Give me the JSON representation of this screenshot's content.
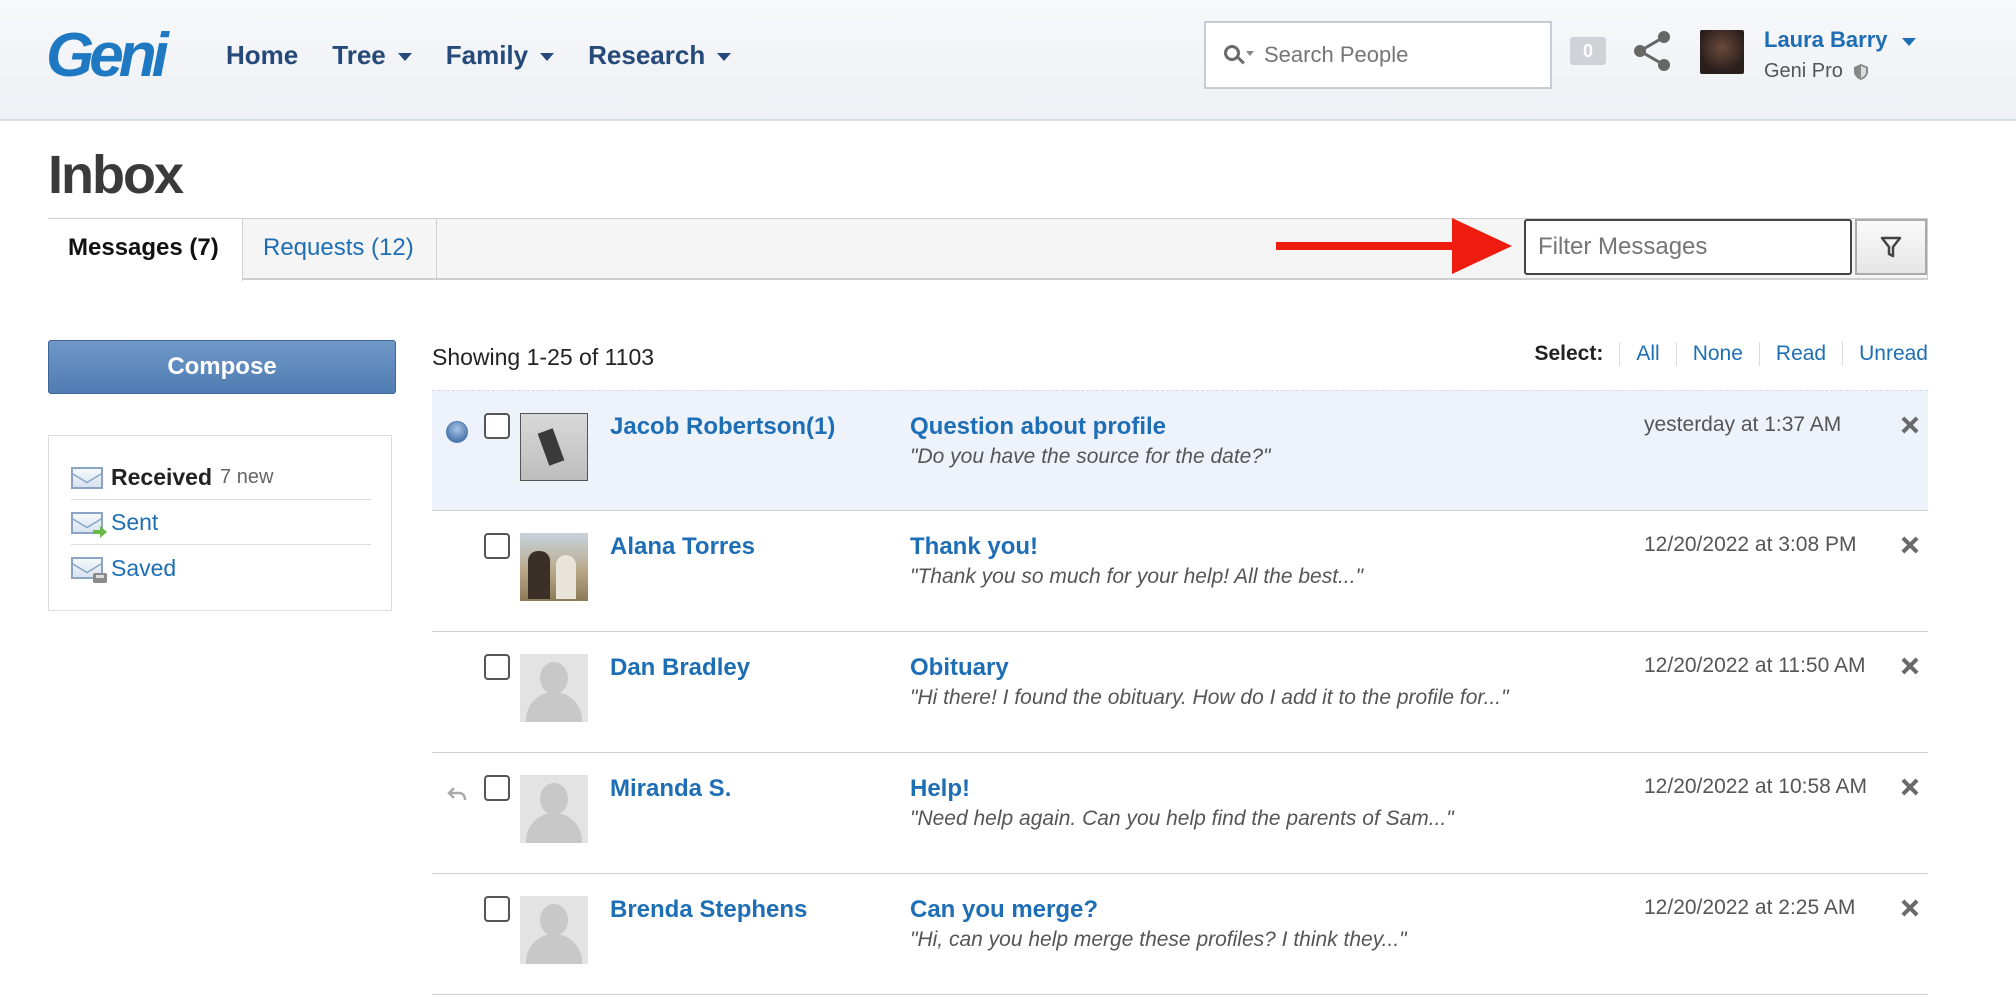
{
  "header": {
    "logo": "Geni",
    "nav": [
      {
        "label": "Home",
        "has_menu": false
      },
      {
        "label": "Tree",
        "has_menu": true
      },
      {
        "label": "Family",
        "has_menu": true
      },
      {
        "label": "Research",
        "has_menu": true
      }
    ],
    "search_placeholder": "Search People",
    "notification_count": "0",
    "user_name": "Laura Barry",
    "user_plan": "Geni Pro"
  },
  "page": {
    "title": "Inbox",
    "tabs": [
      {
        "label": "Messages (7)",
        "active": true
      },
      {
        "label": "Requests (12)",
        "active": false
      }
    ],
    "filter_placeholder": "Filter Messages"
  },
  "sidebar": {
    "compose_label": "Compose",
    "folders": [
      {
        "label": "Received",
        "note": "7 new",
        "icon": "envelope-icon"
      },
      {
        "label": "Sent",
        "note": "",
        "icon": "envelope-send-icon"
      },
      {
        "label": "Saved",
        "note": "",
        "icon": "envelope-save-icon"
      }
    ]
  },
  "list": {
    "showing": "Showing 1-25 of 1103",
    "select_label": "Select:",
    "select_options": [
      "All",
      "None",
      "Read",
      "Unread"
    ],
    "messages": [
      {
        "sender": "Jacob Robertson(1)",
        "subject": "Question about profile",
        "preview": "\"Do you have the source for the date?\"",
        "date": "yesterday at 1:37 AM",
        "status": "unread",
        "thumb": "photo1"
      },
      {
        "sender": "Alana Torres",
        "subject": "Thank you!",
        "preview": "\"Thank you so much for your help! All the best...\"",
        "date": "12/20/2022 at 3:08 PM",
        "status": "",
        "thumb": "photo2"
      },
      {
        "sender": "Dan Bradley",
        "subject": "Obituary",
        "preview": "\"Hi there! I found the obituary. How do I add it to the profile for...\"",
        "date": "12/20/2022 at 11:50 AM",
        "status": "",
        "thumb": "silhouette"
      },
      {
        "sender": "Miranda S.",
        "subject": "Help!",
        "preview": "\"Need help again. Can you help find the parents of Sam...\"",
        "date": "12/20/2022 at 10:58 AM",
        "status": "replied",
        "thumb": "silhouette"
      },
      {
        "sender": "Brenda Stephens",
        "subject": "Can you merge?",
        "preview": "\"Hi, can you help merge these profiles? I think they...\"",
        "date": "12/20/2022 at 2:25 AM",
        "status": "",
        "thumb": "silhouette"
      }
    ]
  },
  "colors": {
    "link": "#1e6eb6",
    "nav": "#254a7a",
    "compose": "#5a85b9",
    "arrow": "#ee1c0f",
    "unread_row": "#eef3fb"
  }
}
